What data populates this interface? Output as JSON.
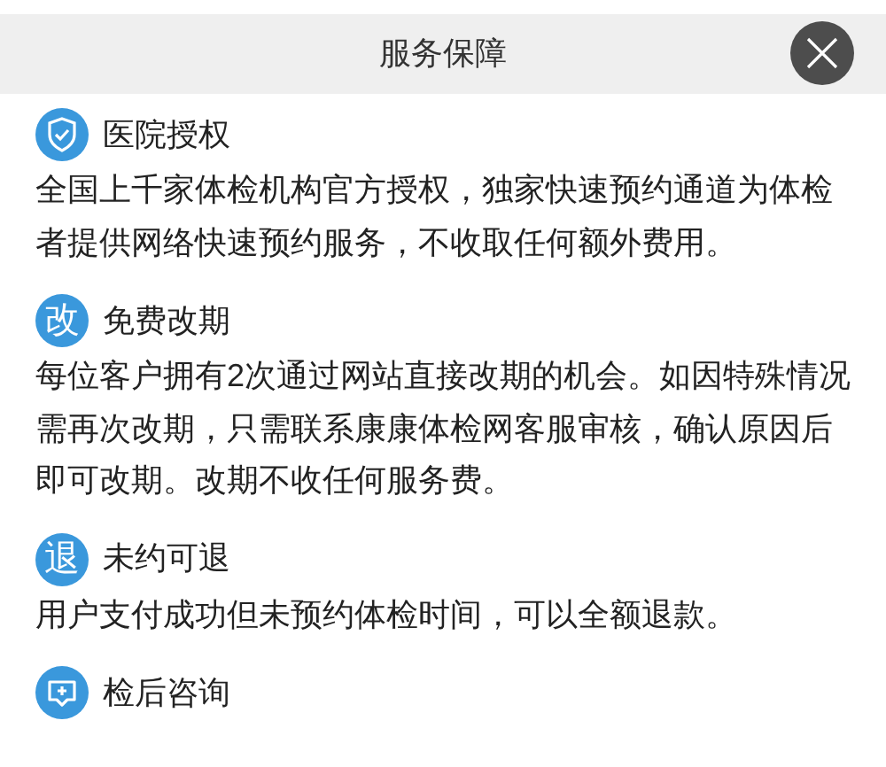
{
  "header": {
    "title": "服务保障"
  },
  "sections": [
    {
      "kind": "shield",
      "title": "医院授权",
      "text": "全国上千家体检机构官方授权，独家快速预约通道为体检者提供网络快速预约服务，不收取任何额外费用。"
    },
    {
      "kind": "char",
      "icon_text": "改",
      "title": "免费改期",
      "text": "每位客户拥有2次通过网站直接改期的机会。如因特殊情况需再次改期，只需联系康康体检网客服审核，确认原因后即可改期。改期不收任何服务费。"
    },
    {
      "kind": "char",
      "icon_text": "退",
      "title": "未约可退",
      "text": "用户支付成功但未预约体检时间，可以全额退款。"
    },
    {
      "kind": "chat",
      "title": "检后咨询"
    }
  ]
}
